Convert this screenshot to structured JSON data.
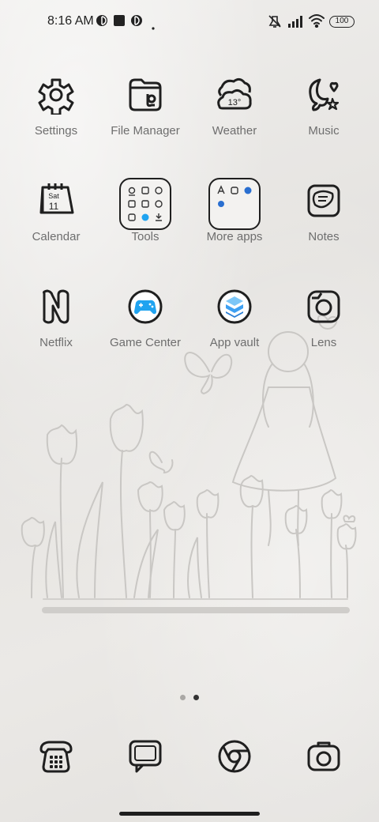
{
  "status_bar": {
    "time": "8:16 AM",
    "battery_level": "100",
    "icons": [
      "theme-icon",
      "stop-icon",
      "theme-icon",
      "dot-icon",
      "mute-icon",
      "signal-icon",
      "wifi-icon",
      "battery-icon"
    ]
  },
  "apps": [
    {
      "label": "Settings",
      "icon": "gear-icon"
    },
    {
      "label": "File Manager",
      "icon": "folder-icon"
    },
    {
      "label": "Weather",
      "icon": "weather-cloud-icon",
      "temperature": "13°"
    },
    {
      "label": "Music",
      "icon": "music-moon-icon"
    },
    {
      "label": "Calendar",
      "icon": "calendar-icon",
      "day": "Sat",
      "date": "11"
    },
    {
      "label": "Tools",
      "icon": "tools-folder-icon"
    },
    {
      "label": "More apps",
      "icon": "more-apps-folder-icon"
    },
    {
      "label": "Notes",
      "icon": "notes-icon"
    },
    {
      "label": "Netflix",
      "icon": "netflix-icon",
      "glyph": "N"
    },
    {
      "label": "Game Center",
      "icon": "gamepad-icon"
    },
    {
      "label": "App vault",
      "icon": "app-vault-icon"
    },
    {
      "label": "Lens",
      "icon": "lens-icon"
    }
  ],
  "page_indicator": {
    "total": 2,
    "current": 2
  },
  "dock": [
    {
      "name": "phone",
      "icon": "phone-icon"
    },
    {
      "name": "messages",
      "icon": "message-icon"
    },
    {
      "name": "browser",
      "icon": "browser-icon"
    },
    {
      "name": "camera",
      "icon": "camera-icon"
    }
  ],
  "colors": {
    "icon_stroke": "#1f1f1f",
    "label_text": "#6e6e6e",
    "game_center_accent": "#1fa3f0",
    "app_vault_accent": "#3ea0f2"
  }
}
